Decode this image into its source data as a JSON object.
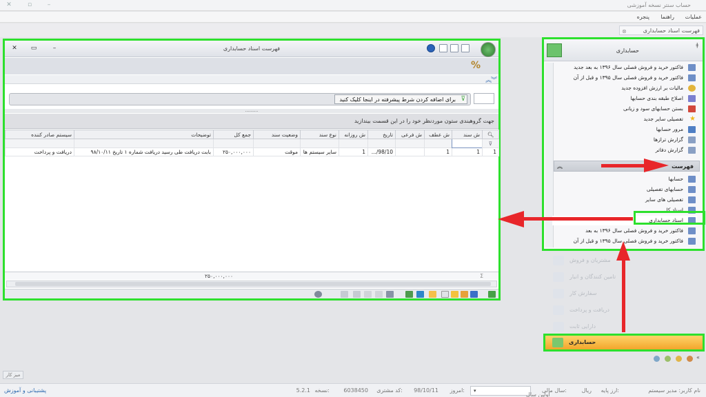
{
  "app": {
    "title": "حساب سنتر نسخه آموزشی"
  },
  "menu": {
    "items": [
      "عملیات",
      "راهنما",
      "پنجره"
    ]
  },
  "doc_tab": {
    "label": "فهرست اسناد حسابداری"
  },
  "window": {
    "title": "فهرست اسناد حسابداری",
    "filter_prompt": "برای اضافه کردن شرط پیشرفته در اینجا کلیک کنید",
    "group_prompt": "جهت گروهبندی ستون موردنظر خود را در این قسمت بیندازید",
    "grip": "..........",
    "columns": [
      "ش سند",
      "ش عطف",
      "ش فرعی",
      "تاریخ",
      "ش روزانه",
      "نوع سند",
      "وضعیت سند",
      "جمع کل",
      "توضیحات",
      "سیستم صادر کننده"
    ],
    "rows": [
      {
        "row_no": "1",
        "doc_no": "1",
        "ref_no": "1",
        "sub_no": "",
        "date": "98/10/...",
        "daily_no": "1",
        "doc_type": "سایر سیستم ها",
        "status": "موقت",
        "total": "۲۵۰,۰۰۰,۰۰۰",
        "desc": "بابت دریافت طی رسید دریافت شماره ۱ تاریخ ۹۸/۱۰/۱۱",
        "system": "دریافت و پرداخت"
      }
    ],
    "sum_total": "۲۵۰,۰۰۰,۰۰۰",
    "sum_symbol": "Σ",
    "percent_symbol": "%"
  },
  "sidebar": {
    "title": "حسابداری",
    "items_top": [
      "فاکتور خرید و فروش فصلی سال ۱۳۹۶ به بعد جدید",
      "فاکتور خرید و فروش فصلی سال ۱۳۹۵ و قبل از آن",
      "مالیات بر ارزش افزوده جدید",
      "اصلاح طبقه بندی حسابها",
      "بستن حسابهای سود و زیانی",
      "تفصیلی سایر جدید",
      "مرور حسابها",
      "گزارش ترازها",
      "گزارش دفاتر"
    ],
    "section_title": "فهرست",
    "items_list": [
      "حسابها",
      "حسابهای تفصیلی",
      "تفصیلی های سایر",
      "اسناد کل",
      "اسناد حسابداری",
      "فاکتور خرید و فروش فصلی سال ۱۳۹۶ به بعد",
      "فاکتور خرید و فروش فصلی سال ۱۳۹۵ و قبل از آن"
    ]
  },
  "modules": [
    "مشتریان و فروش",
    "تامین کنندگان و انبار",
    "سفارش کار",
    "دریافت و پرداخت",
    "دارایی ثابت"
  ],
  "active_module": "حسابداری",
  "desk_button": "میز کار",
  "status": {
    "user": "نام کاربر: مدیر سیستم",
    "base": "ارز پایه:",
    "currency": "ریال",
    "fiscal_label": "سال مالی:",
    "fiscal_value": "اولین سال",
    "today_label": "امروز:",
    "today_value": "98/10/11",
    "customer_label": "کد مشتری:",
    "customer_value": "6038450",
    "version_label": "نسخه:",
    "version_value": "5.2.1",
    "support": "پشتیبانی و آموزش"
  },
  "colors": {
    "highlight": "#2de02d",
    "arrow": "#e8262a",
    "active_module": "#f5b23c"
  }
}
